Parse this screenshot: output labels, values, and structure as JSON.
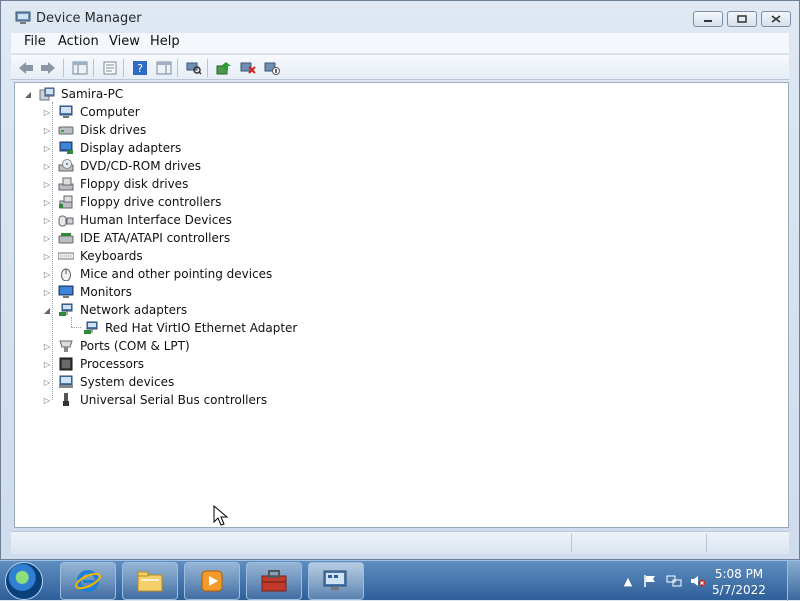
{
  "window": {
    "title": "Device Manager"
  },
  "menubar": {
    "items": [
      "File",
      "Action",
      "View",
      "Help"
    ]
  },
  "toolbar": {
    "buttons": [
      {
        "icon": "back-arrow-icon"
      },
      {
        "icon": "forward-arrow-icon"
      },
      {
        "icon": "show-hide-tree-icon"
      },
      {
        "icon": "properties-icon"
      },
      {
        "icon": "help-icon"
      },
      {
        "icon": "action-pane-icon"
      },
      {
        "icon": "scan-hardware-icon"
      },
      {
        "icon": "update-driver-icon"
      },
      {
        "icon": "uninstall-icon"
      },
      {
        "icon": "disable-icon"
      }
    ]
  },
  "tree": {
    "root": "Samira-PC",
    "nodes": [
      {
        "label": "Computer",
        "icon": "computer-icon",
        "expanded": false
      },
      {
        "label": "Disk drives",
        "icon": "disk-drive-icon",
        "expanded": false
      },
      {
        "label": "Display adapters",
        "icon": "display-adapter-icon",
        "expanded": false
      },
      {
        "label": "DVD/CD-ROM drives",
        "icon": "dvd-drive-icon",
        "expanded": false
      },
      {
        "label": "Floppy disk drives",
        "icon": "floppy-drive-icon",
        "expanded": false
      },
      {
        "label": "Floppy drive controllers",
        "icon": "floppy-controller-icon",
        "expanded": false
      },
      {
        "label": "Human Interface Devices",
        "icon": "hid-icon",
        "expanded": false
      },
      {
        "label": "IDE ATA/ATAPI controllers",
        "icon": "ide-controller-icon",
        "expanded": false
      },
      {
        "label": "Keyboards",
        "icon": "keyboard-icon",
        "expanded": false
      },
      {
        "label": "Mice and other pointing devices",
        "icon": "mouse-icon",
        "expanded": false
      },
      {
        "label": "Monitors",
        "icon": "monitor-icon",
        "expanded": false
      },
      {
        "label": "Network adapters",
        "icon": "network-adapter-icon",
        "expanded": true
      },
      {
        "label": "Red Hat VirtIO Ethernet Adapter",
        "icon": "ethernet-adapter-icon",
        "child": true
      },
      {
        "label": "Ports (COM & LPT)",
        "icon": "port-icon",
        "expanded": false
      },
      {
        "label": "Processors",
        "icon": "processor-icon",
        "expanded": false
      },
      {
        "label": "System devices",
        "icon": "system-device-icon",
        "expanded": false
      },
      {
        "label": "Universal Serial Bus controllers",
        "icon": "usb-icon",
        "expanded": false
      }
    ]
  },
  "taskbar": {
    "apps": [
      {
        "icon": "internet-explorer-icon"
      },
      {
        "icon": "file-explorer-icon"
      },
      {
        "icon": "media-player-icon"
      },
      {
        "icon": "toolbox-icon"
      },
      {
        "icon": "device-manager-icon"
      }
    ],
    "tray": {
      "icons": [
        "show-hidden-icons-icon",
        "action-center-flag-icon",
        "network-icon",
        "volume-muted-icon"
      ],
      "time": "5:08 PM",
      "date": "5/7/2022"
    }
  },
  "colors": {
    "taskbar_top": "#5f8fc0",
    "taskbar_bottom": "#2f5f99",
    "window_frame": "#dfe8f3",
    "tree_bg": "#ffffff"
  }
}
